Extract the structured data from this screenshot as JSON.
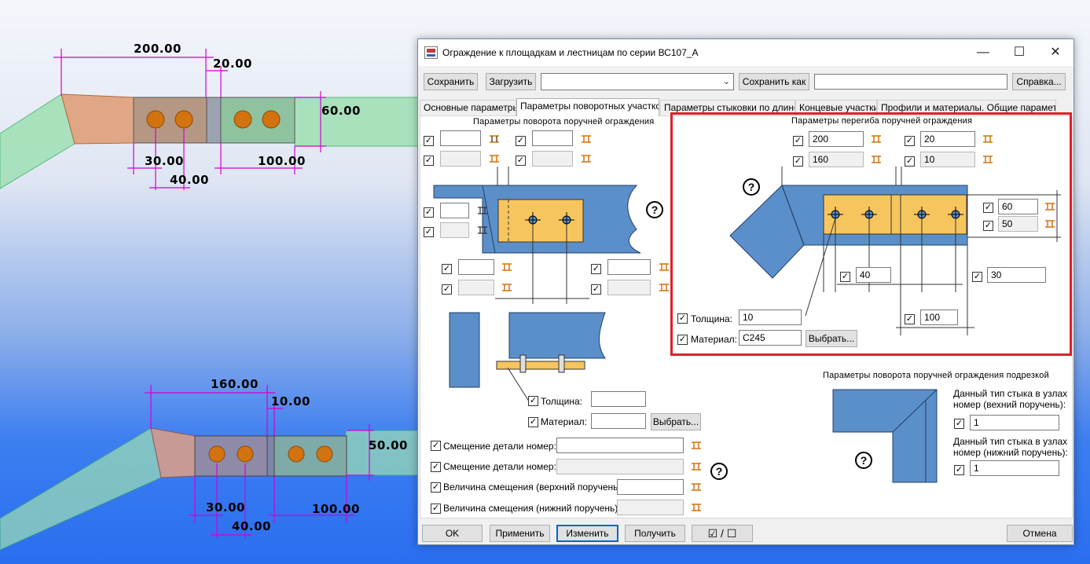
{
  "cad_top": {
    "dim_width": "200.00",
    "dim_gap": "20.00",
    "dim_height": "60.00",
    "dim_bolt_edge": "30.00",
    "dim_bolt_pitch": "40.00",
    "dim_plate_len": "100.00"
  },
  "cad_bottom": {
    "dim_width": "160.00",
    "dim_gap": "10.00",
    "dim_height": "50.00",
    "dim_bolt_edge": "30.00",
    "dim_bolt_pitch": "40.00",
    "dim_plate_len": "100.00"
  },
  "window": {
    "title": "Ограждение к площадкам и лестницам по серии ВС107_А",
    "minimize": "—",
    "maximize": "☐",
    "close": "✕"
  },
  "toolbar": {
    "save": "Сохранить",
    "load": "Загрузить",
    "preset_value": "",
    "save_as": "Сохранить как",
    "save_as_name": "",
    "help": "Справка..."
  },
  "tabs": [
    {
      "label": "Основные параметры"
    },
    {
      "label": "Параметры поворотных участков"
    },
    {
      "label": "Параметры стыковки по длине"
    },
    {
      "label": "Концевые участки"
    },
    {
      "label": "Профили и материалы. Общие параметры."
    }
  ],
  "left_panel": {
    "header": "Параметры  поворота  поручней  ограждения",
    "thickness_label": "Толщина:",
    "thickness_value": "",
    "material_label": "Материал:",
    "material_value": "",
    "choose": "Выбрать...",
    "offset1_label": "Смещение детали номер:",
    "offset1_value": "",
    "offset2_label": "Смещение детали номер:",
    "offset2_value": "",
    "shift_top_label": "Величина смещения (верхний поручень):",
    "shift_top_value": "",
    "shift_bottom_label": "Величина смещения (нижний поручень):",
    "shift_bottom_value": ""
  },
  "bend_panel": {
    "header": "Параметры  перегиба  поручней  ограждения",
    "f1": "200",
    "f2": "20",
    "f3": "160",
    "f4": "10",
    "f5": "60",
    "f6": "50",
    "f7": "40",
    "f8": "30",
    "f9": "100",
    "thickness_label": "Толщина:",
    "thickness_value": "10",
    "material_label": "Материал:",
    "material_value": "С245",
    "choose": "Выбрать..."
  },
  "cut_panel": {
    "header": "Параметры  поворота  поручней  ограждения  подрезкой",
    "top_label_1": "Данный тип стыка в узлах",
    "top_label_2": "номер (вехний поручень):",
    "top_value": "1",
    "bottom_label_1": "Данный тип стыка в узлах",
    "bottom_label_2": "номер (нижний поручень):",
    "bottom_value": "1"
  },
  "help_mark": "?",
  "check_mark": "✓",
  "bottom_buttons": {
    "ok": "OK",
    "apply": "Применить",
    "modify": "Изменить",
    "get": "Получить",
    "toggle": "☑ / ☐",
    "cancel": "Отмена"
  },
  "colors": {
    "steel": "#5b8fc9",
    "plate": "#f7c55e",
    "bolt": "#d2730f",
    "dim": "#d400d4",
    "highlight": "#e0202c",
    "rail": "#8fd9a8"
  }
}
